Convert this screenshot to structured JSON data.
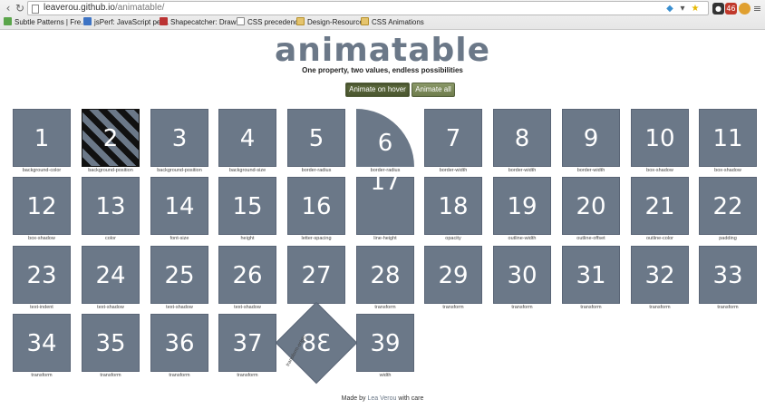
{
  "browser": {
    "url_host": "leaverou.github.io",
    "url_path": "/animatable/",
    "nav": {
      "back_icon": "back-arrow",
      "forward_icon": "forward-arrow",
      "reload_icon": "reload"
    },
    "bookmarks": [
      {
        "label": "Subtle Patterns | Fre...",
        "icon": "green"
      },
      {
        "label": "jsPerf: JavaScript per...",
        "icon": "blue"
      },
      {
        "label": "Shapecatcher: Draw ...",
        "icon": "red"
      },
      {
        "label": "CSS precedence",
        "icon": "page"
      },
      {
        "label": "Design-Resources",
        "icon": "folder"
      },
      {
        "label": "CSS Animations",
        "icon": "folder"
      }
    ],
    "extensions": {
      "badge": "46"
    }
  },
  "page": {
    "title": "animatable",
    "subtitle": "One property, two values, endless possibilities",
    "buttons": {
      "hover": "Animate on hover",
      "all": "Animate all"
    },
    "tiles": [
      {
        "n": "1",
        "label": "background-color"
      },
      {
        "n": "2",
        "label": "background-position"
      },
      {
        "n": "3",
        "label": "background-position"
      },
      {
        "n": "4",
        "label": "background-size"
      },
      {
        "n": "5",
        "label": "border-radius"
      },
      {
        "n": "6",
        "label": "border-radius"
      },
      {
        "n": "7",
        "label": "border-width"
      },
      {
        "n": "8",
        "label": "border-width"
      },
      {
        "n": "9",
        "label": "border-width"
      },
      {
        "n": "10",
        "label": "box-shadow"
      },
      {
        "n": "11",
        "label": "box-shadow"
      },
      {
        "n": "12",
        "label": "box-shadow"
      },
      {
        "n": "13",
        "label": "color"
      },
      {
        "n": "14",
        "label": "font-size"
      },
      {
        "n": "15",
        "label": "height"
      },
      {
        "n": "16",
        "label": "letter-spacing"
      },
      {
        "n": "17",
        "label": "line-height"
      },
      {
        "n": "18",
        "label": "opacity"
      },
      {
        "n": "19",
        "label": "outline-width"
      },
      {
        "n": "20",
        "label": "outline-offset"
      },
      {
        "n": "21",
        "label": "outline-color"
      },
      {
        "n": "22",
        "label": "padding"
      },
      {
        "n": "23",
        "label": "text-indent"
      },
      {
        "n": "24",
        "label": "text-shadow"
      },
      {
        "n": "25",
        "label": "text-shadow"
      },
      {
        "n": "26",
        "label": "text-shadow"
      },
      {
        "n": "27",
        "label": ""
      },
      {
        "n": "28",
        "label": "transform"
      },
      {
        "n": "29",
        "label": "transform"
      },
      {
        "n": "30",
        "label": "transform"
      },
      {
        "n": "31",
        "label": "transform"
      },
      {
        "n": "32",
        "label": "transform"
      },
      {
        "n": "33",
        "label": "transform"
      },
      {
        "n": "34",
        "label": "transform"
      },
      {
        "n": "35",
        "label": "transform"
      },
      {
        "n": "36",
        "label": "transform"
      },
      {
        "n": "37",
        "label": "transform"
      },
      {
        "n": "38",
        "label": "transform-origin"
      },
      {
        "n": "39",
        "label": "width"
      }
    ],
    "footer": {
      "prefix": "Made by",
      "author": "Lea Verou",
      "suffix": "with care"
    }
  },
  "colors": {
    "tile": "#6b7888",
    "button": "#7a8858",
    "title": "#6b7888"
  }
}
